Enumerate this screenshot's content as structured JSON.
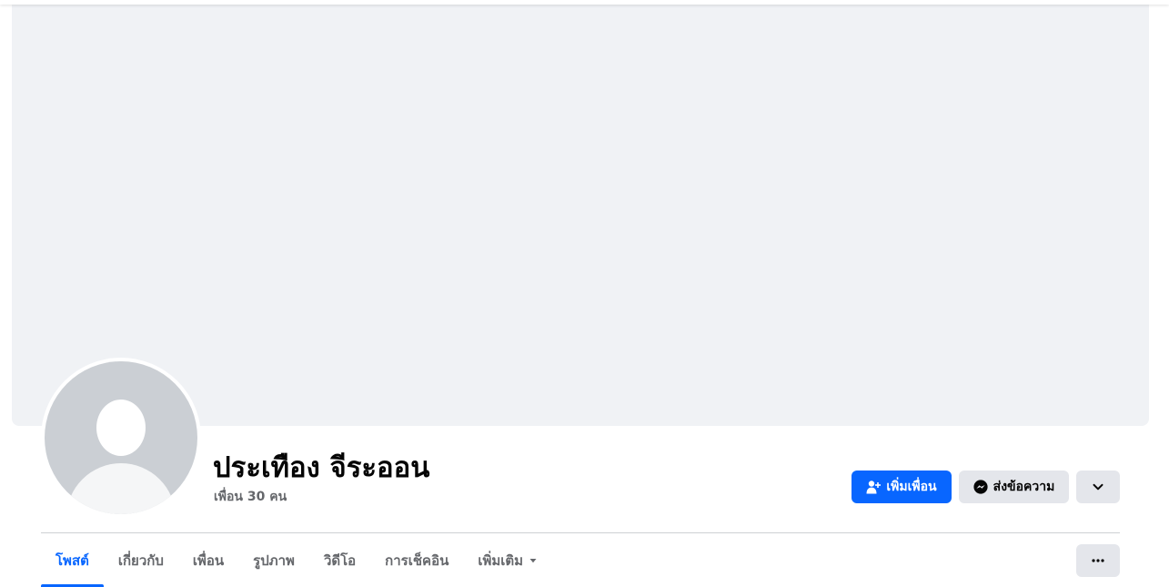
{
  "profile": {
    "name": "ประเทือง จีระออน",
    "friends_count": "เพื่อน 30 คน"
  },
  "actions": {
    "add_friend_label": "เพิ่มเพื่อน",
    "message_label": "ส่งข้อความ"
  },
  "tabs": [
    {
      "label": "โพสต์",
      "active": true
    },
    {
      "label": "เกี่ยวกับ",
      "active": false
    },
    {
      "label": "เพื่อน",
      "active": false
    },
    {
      "label": "รูปภาพ",
      "active": false
    },
    {
      "label": "วิดีโอ",
      "active": false
    },
    {
      "label": "การเช็คอิน",
      "active": false
    },
    {
      "label": "เพิ่มเติม",
      "active": false
    }
  ],
  "icons": {
    "add_friend": "person-add-icon",
    "message": "messenger-icon",
    "chevron": "chevron-down-icon",
    "more_caret": "caret-down-icon",
    "options": "more-horizontal-icon"
  },
  "colors": {
    "accent": "#0866ff",
    "cover_bg": "#f0f2f5",
    "secondary_button": "#e4e6eb",
    "avatar_bg": "#cbcfd4",
    "muted_text": "#65676b"
  }
}
